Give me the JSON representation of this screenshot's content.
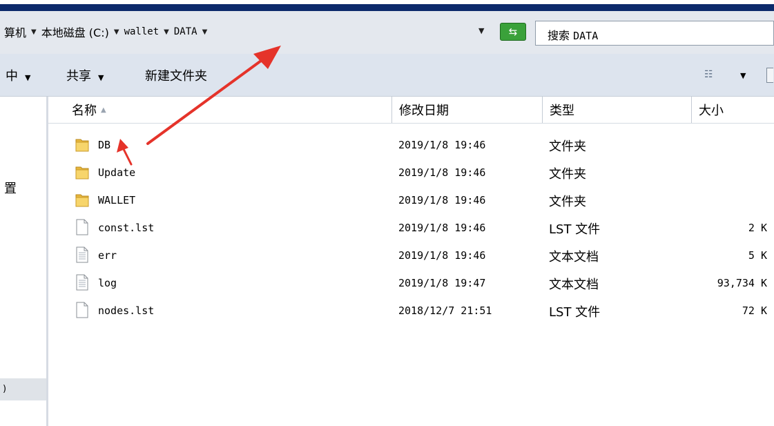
{
  "address_bar": {
    "crumbs": [
      "算机",
      "本地磁盘 (C:)",
      "wallet",
      "DATA"
    ],
    "refresh_icon": "refresh-icon"
  },
  "search": {
    "prefix": "搜索",
    "folder": "DATA"
  },
  "toolbar": {
    "items": [
      "中",
      "共享",
      "新建文件夹"
    ],
    "view_icon": "view-list-icon"
  },
  "nav": {
    "item1": "置",
    "item2": ")"
  },
  "columns": [
    "名称",
    "修改日期",
    "类型",
    "大小"
  ],
  "files": [
    {
      "name": "DB",
      "date": "2019/1/8 19:46",
      "type": "文件夹",
      "size": "",
      "icon": "folder-icon"
    },
    {
      "name": "Update",
      "date": "2019/1/8 19:46",
      "type": "文件夹",
      "size": "",
      "icon": "folder-icon"
    },
    {
      "name": "WALLET",
      "date": "2019/1/8 19:46",
      "type": "文件夹",
      "size": "",
      "icon": "folder-icon"
    },
    {
      "name": "const.lst",
      "date": "2019/1/8 19:46",
      "type": "LST 文件",
      "size": "2 K",
      "icon": "file-icon"
    },
    {
      "name": "err",
      "date": "2019/1/8 19:46",
      "type": "文本文档",
      "size": "5 K",
      "icon": "text-file-icon"
    },
    {
      "name": "log",
      "date": "2019/1/8 19:47",
      "type": "文本文档",
      "size": "93,734 K",
      "icon": "text-file-icon"
    },
    {
      "name": "nodes.lst",
      "date": "2018/12/7 21:51",
      "type": "LST 文件",
      "size": "72 K",
      "icon": "file-icon"
    }
  ],
  "colors": {
    "annotation_arrow": "#e5332a",
    "title_bar": "#0c2a6b"
  }
}
